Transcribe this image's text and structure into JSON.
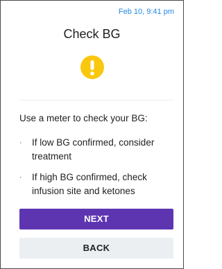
{
  "status_bar": {
    "timestamp": "Feb 10, 9:41 pm"
  },
  "dialog": {
    "title": "Check BG",
    "icon": "exclamation-alert-icon",
    "icon_color": "#f9c80e",
    "instruction": "Use a meter to check your BG:",
    "bullets": [
      "If low BG confirmed, consider treatment",
      "If high BG confirmed, check infusion site and ketones"
    ],
    "bullet_glyph": "·"
  },
  "actions": {
    "next_label": "NEXT",
    "back_label": "BACK",
    "primary_color": "#5e35b1",
    "secondary_color": "#eceff1"
  }
}
